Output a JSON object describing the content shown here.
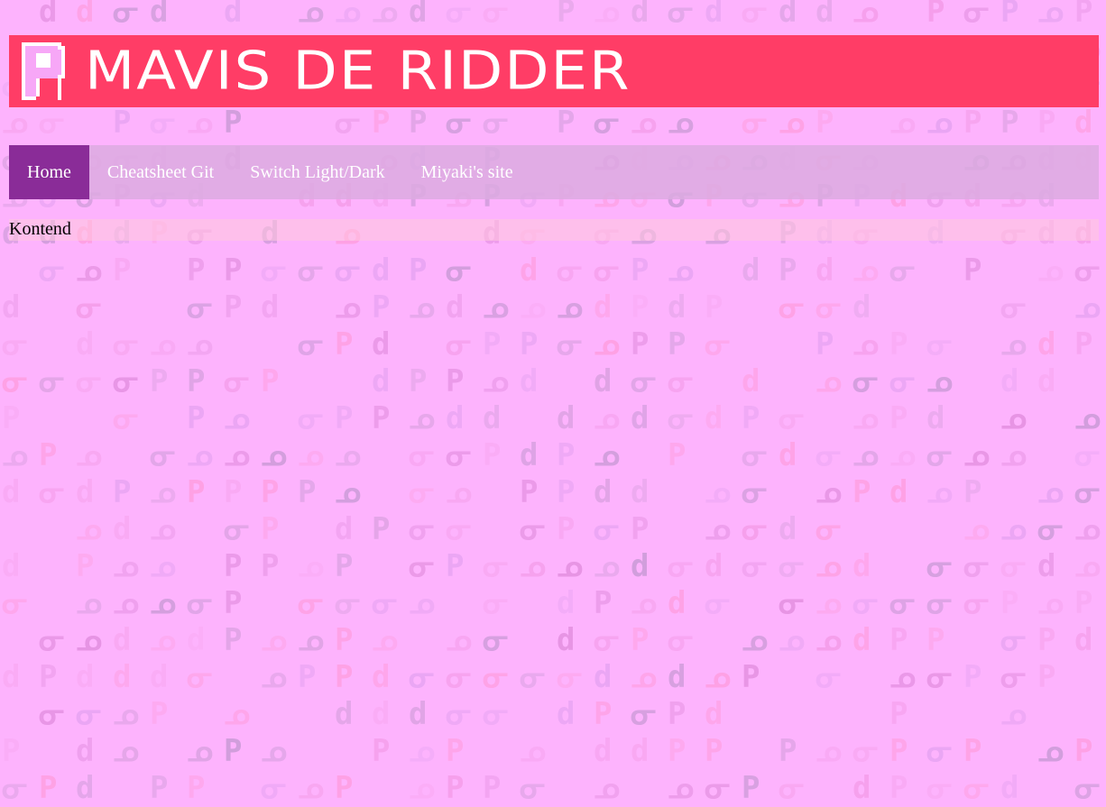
{
  "colors": {
    "page_background": "#fdb3fd",
    "banner_background": "#ff3d66",
    "nav_background": "#dca8e4",
    "nav_active_background": "#8a2c98",
    "pattern_glyph_colors": [
      "#f49be8",
      "#e38fe0",
      "#d9a0e0",
      "#f8a6f0",
      "#c99ad6",
      "#ff9ee0",
      "#e6a3f2"
    ]
  },
  "header": {
    "logo_icon": "pixel-letter-p-logo",
    "title": "MAVIS DE RIDDER"
  },
  "nav": {
    "items": [
      {
        "label": "Home",
        "active": true
      },
      {
        "label": "Cheatsheet Git",
        "active": false
      },
      {
        "label": "Switch Light/Dark",
        "active": false
      },
      {
        "label": "Miyaki's site",
        "active": false
      }
    ]
  },
  "main": {
    "content_text": "Kontend"
  },
  "background": {
    "pattern_glyphs": [
      "P",
      "d",
      "ᓂ",
      "ᓄ"
    ]
  }
}
